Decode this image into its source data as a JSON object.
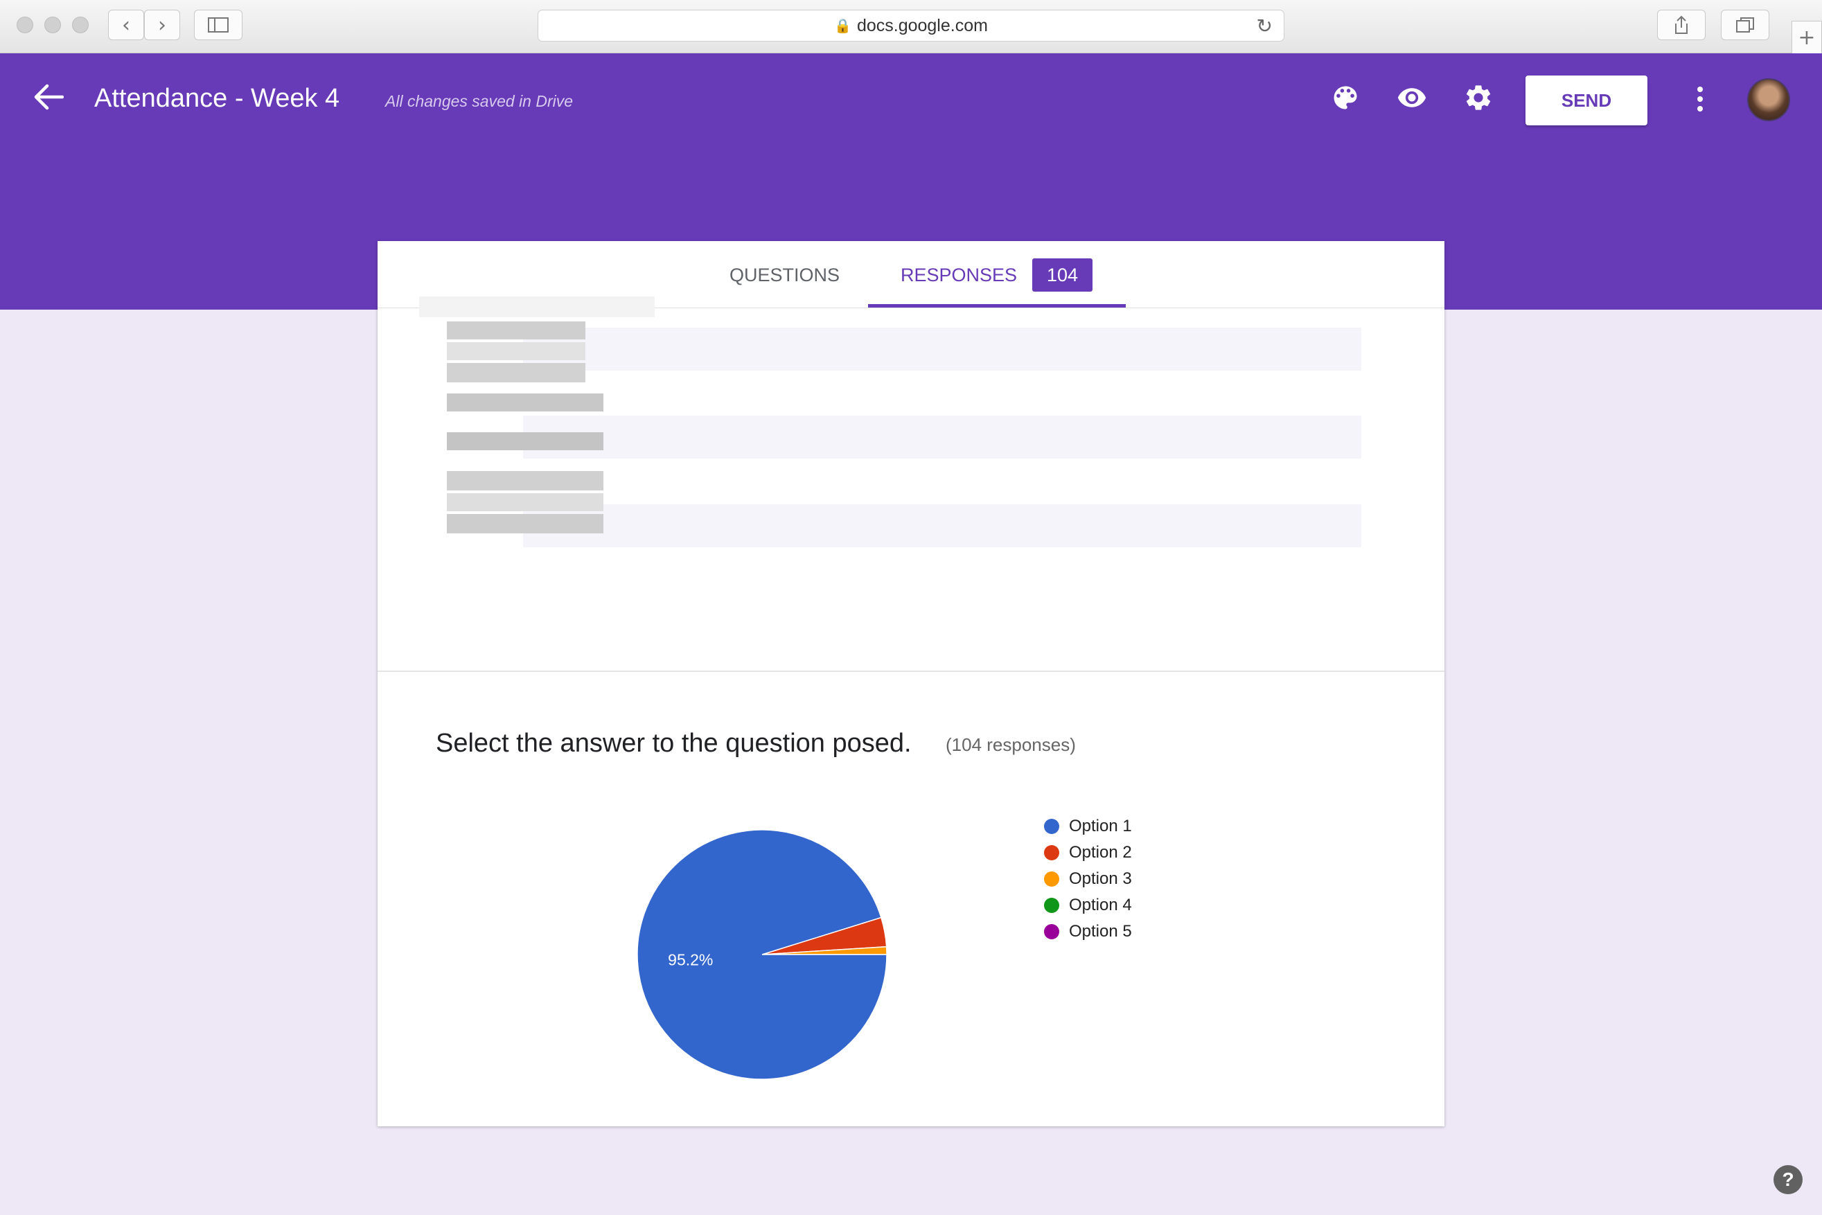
{
  "browser": {
    "url": "docs.google.com"
  },
  "header": {
    "title": "Attendance - Week 4",
    "saved_status": "All changes saved in Drive",
    "send_label": "SEND"
  },
  "tabs": {
    "questions_label": "QUESTIONS",
    "responses_label": "RESPONSES",
    "responses_count": "104"
  },
  "question": {
    "title": "Select the answer to the question posed.",
    "response_count": "(104 responses)"
  },
  "colors": {
    "brand": "#673ab7",
    "option1": "#3366cc",
    "option2": "#dc3912",
    "option3": "#ff9900",
    "option4": "#109618",
    "option5": "#990099"
  },
  "chart_data": {
    "type": "pie",
    "categories": [
      "Option 1",
      "Option 2",
      "Option 3",
      "Option 4",
      "Option 5"
    ],
    "values": [
      95.2,
      3.8,
      1.0,
      0,
      0
    ],
    "colors": [
      "#3366cc",
      "#dc3912",
      "#ff9900",
      "#109618",
      "#990099"
    ],
    "data_labels": [
      "95.2%",
      "",
      "",
      "",
      ""
    ],
    "legend": "right"
  }
}
